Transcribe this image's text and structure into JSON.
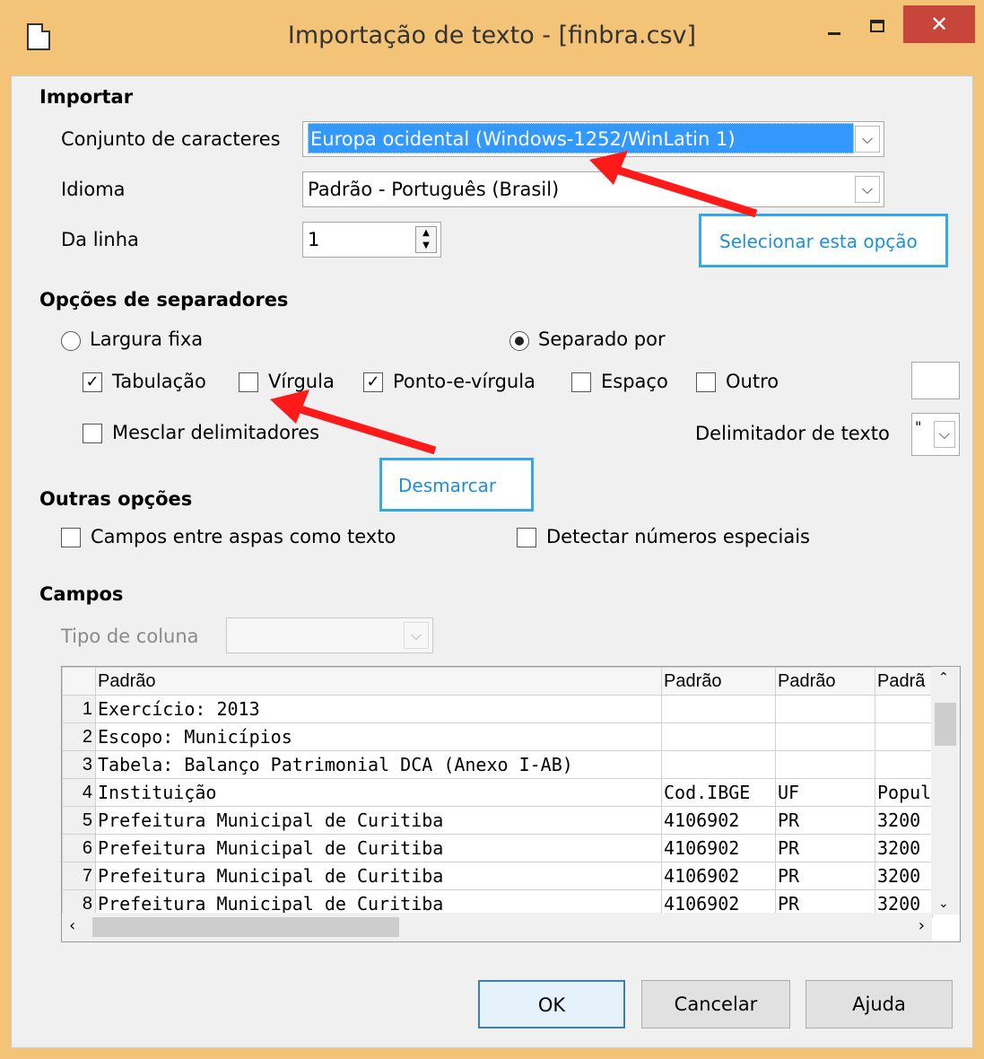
{
  "window": {
    "title": "Importação de texto - [finbra.csv]",
    "close_glyph": "✕"
  },
  "importar": {
    "heading": "Importar",
    "charset_label": "Conjunto de caracteres",
    "charset_value": "Europa ocidental (Windows-1252/WinLatin 1)",
    "language_label": "Idioma",
    "language_value": "Padrão - Português (Brasil)",
    "from_row_label": "Da linha",
    "from_row_value": "1"
  },
  "separators": {
    "heading": "Opções de separadores",
    "fixed_width": "Largura fixa",
    "separated_by": "Separado por",
    "tab": "Tabulação",
    "comma": "Vírgula",
    "semicolon": "Ponto-e-vírgula",
    "space": "Espaço",
    "other": "Outro",
    "merge": "Mesclar delimitadores",
    "text_delimiter_label": "Delimitador de texto",
    "text_delimiter_value": "\"",
    "tab_checked": true,
    "comma_checked": false,
    "semicolon_checked": true,
    "space_checked": false,
    "other_checked": false,
    "merge_checked": false
  },
  "other_options": {
    "heading": "Outras opções",
    "quoted_as_text": "Campos entre aspas como texto",
    "detect_special": "Detectar números especiais"
  },
  "fields": {
    "heading": "Campos",
    "column_type_label": "Tipo de coluna",
    "headers": [
      "Padrão",
      "Padrão",
      "Padrão",
      "Padrã"
    ],
    "rows": [
      [
        "1",
        "Exercício: 2013",
        "",
        "",
        ""
      ],
      [
        "2",
        "Escopo: Municípios",
        "",
        "",
        ""
      ],
      [
        "3",
        "Tabela: Balanço Patrimonial DCA (Anexo I-AB)",
        "",
        "",
        ""
      ],
      [
        "4",
        "Instituição",
        "Cod.IBGE",
        "UF",
        "Popul"
      ],
      [
        "5",
        "Prefeitura Municipal de Curitiba",
        "4106902",
        "PR",
        "3200"
      ],
      [
        "6",
        "Prefeitura Municipal de Curitiba",
        "4106902",
        "PR",
        "3200"
      ],
      [
        "7",
        "Prefeitura Municipal de Curitiba",
        "4106902",
        "PR",
        "3200"
      ],
      [
        "8",
        "Prefeitura Municipal de Curitiba",
        "4106902",
        "PR",
        "3200"
      ]
    ]
  },
  "buttons": {
    "ok": "OK",
    "cancel": "Cancelar",
    "help": "Ajuda"
  },
  "annotations": {
    "select_option": "Selecionar esta opção",
    "uncheck": "Desmarcar",
    "arrow_color": "#ff1a1a",
    "box_color": "#35a9e6"
  }
}
